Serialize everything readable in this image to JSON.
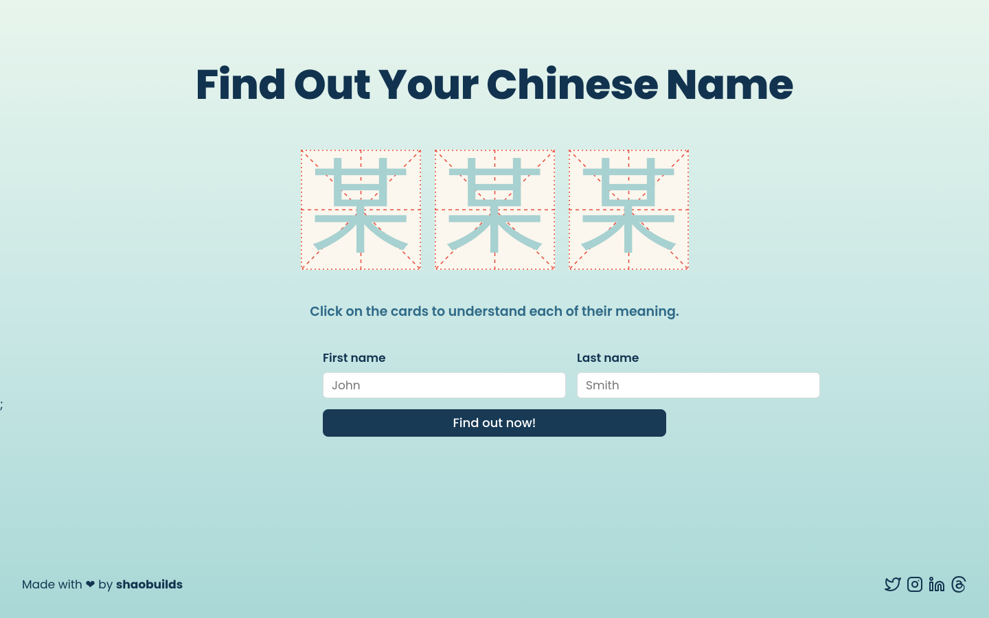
{
  "header": {
    "title": "Find Out Your Chinese Name"
  },
  "cards": {
    "glyph": "某",
    "count": 3
  },
  "hint": "Click on the cards to understand each of their meaning.",
  "form": {
    "first_label": "First name",
    "first_placeholder": "John",
    "first_value": "",
    "last_label": "Last name",
    "last_placeholder": "Smith",
    "last_value": "",
    "submit_label": "Find out now!"
  },
  "stray": ";",
  "footer": {
    "prefix": "Made with ❤ by ",
    "author": "shaobuilds"
  },
  "icons": {
    "twitter": "twitter-icon",
    "instagram": "instagram-icon",
    "linkedin": "linkedin-icon",
    "threads": "threads-icon"
  },
  "colors": {
    "ink": "#12334f",
    "accentText": "#2f6a88",
    "cardBg": "#fbf7ee",
    "dash": "#e74a3b",
    "glyph": "#a8d1d1",
    "buttonBg": "#183a55"
  }
}
